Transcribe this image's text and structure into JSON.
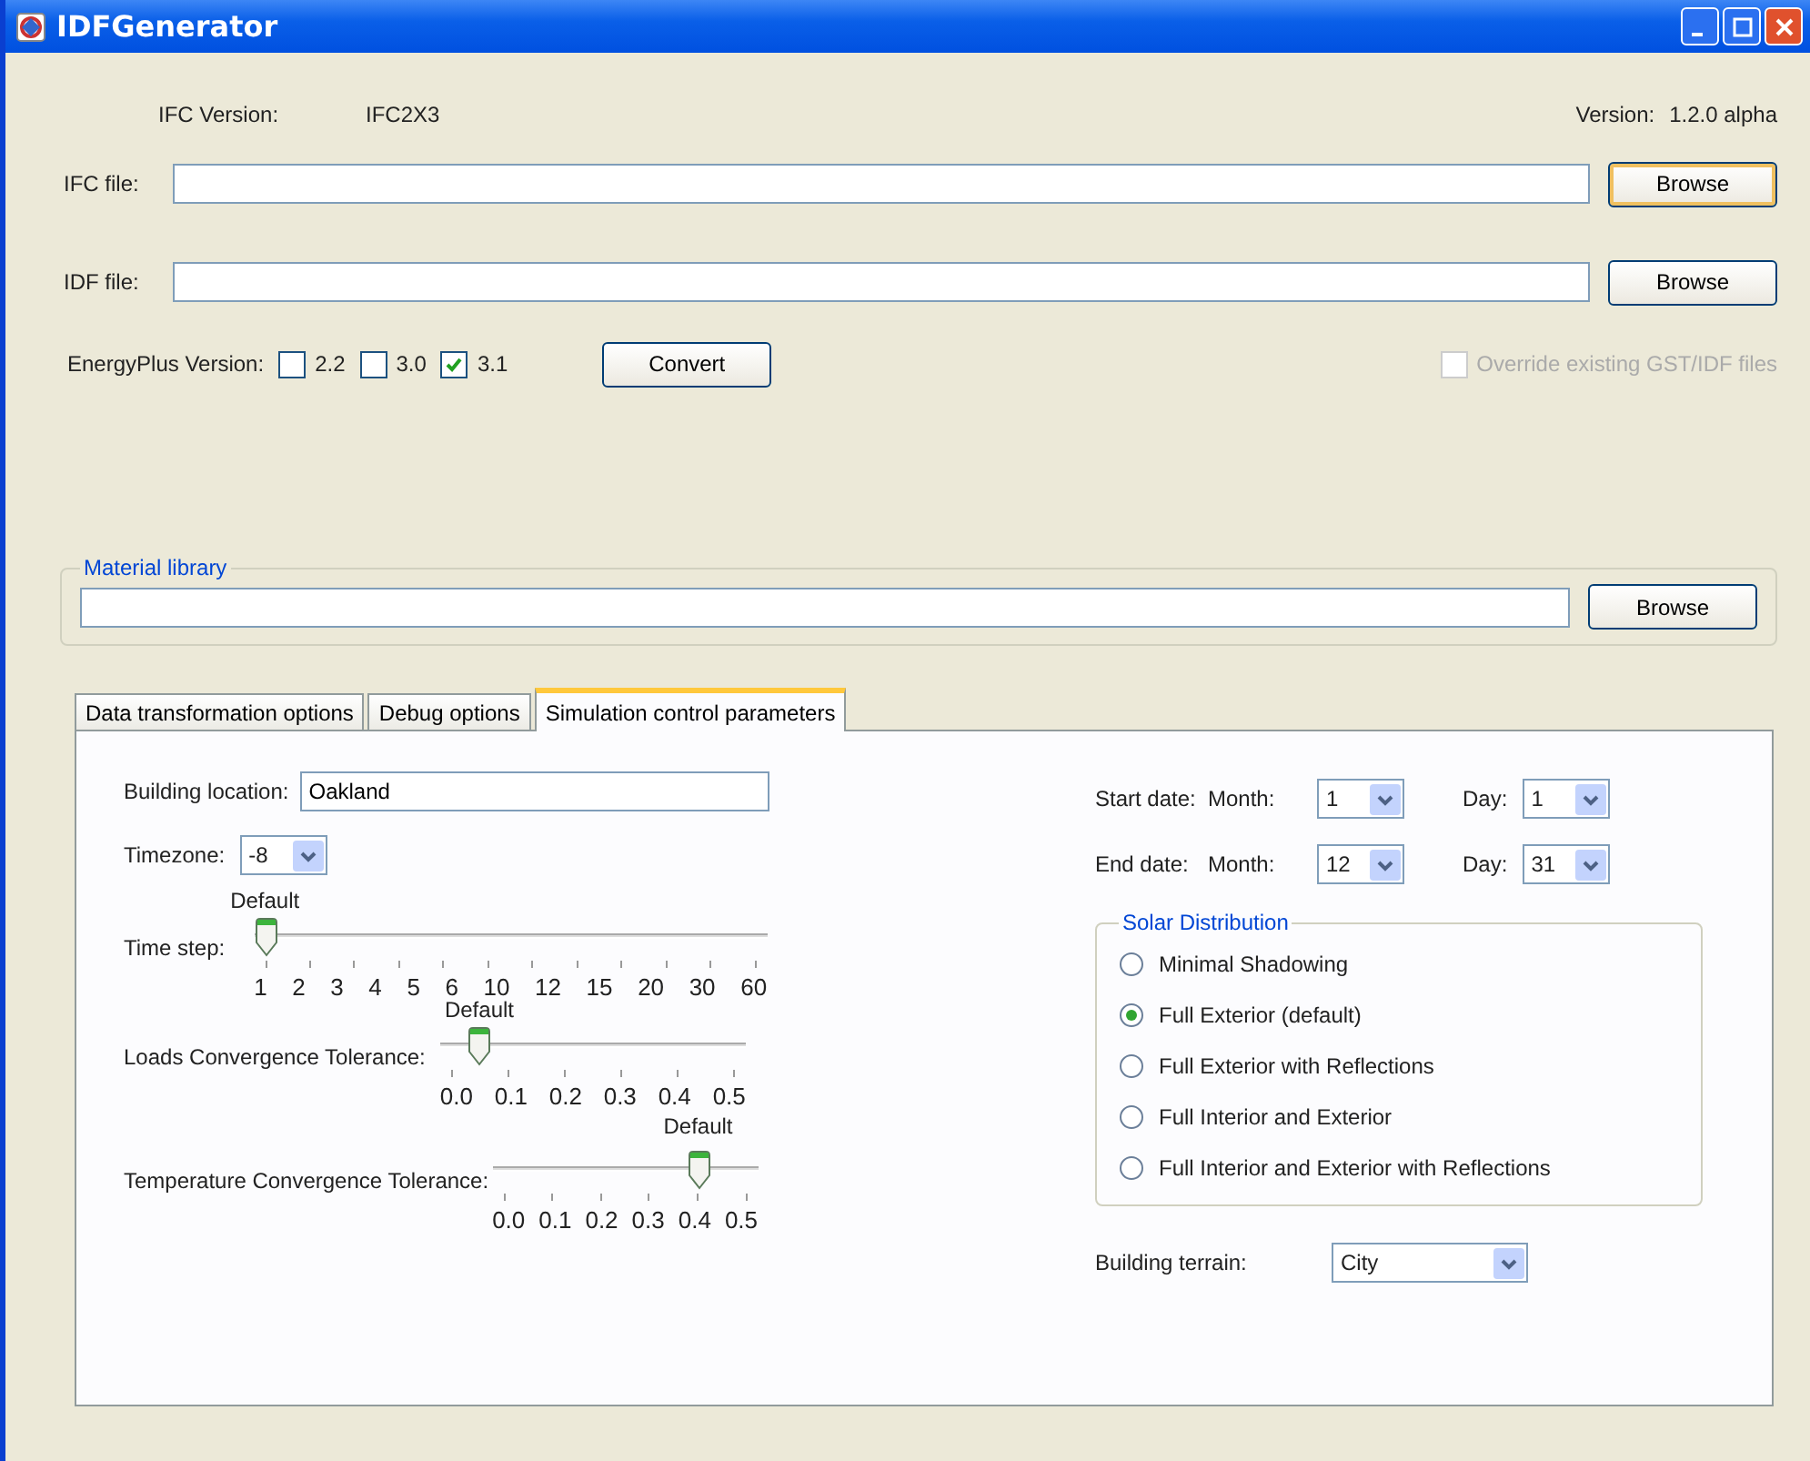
{
  "window": {
    "title": "IDFGenerator"
  },
  "ifc_version": {
    "label": "IFC Version:",
    "value": "IFC2X3"
  },
  "app_version": {
    "label": "Version:",
    "value": "1.2.0 alpha"
  },
  "ifc_file": {
    "label": "IFC file:",
    "button": "Browse",
    "focused": true
  },
  "idf_file": {
    "label": "IDF file:",
    "button": "Browse",
    "focused": false
  },
  "energyplus": {
    "label": "EnergyPlus Version:",
    "options": [
      {
        "label": "2.2",
        "checked": false
      },
      {
        "label": "3.0",
        "checked": false
      },
      {
        "label": "3.1",
        "checked": true
      }
    ]
  },
  "convert_button": "Convert",
  "override": {
    "label": "Override existing GST/IDF files",
    "checked": false,
    "disabled": true
  },
  "material_library": {
    "title": "Material library",
    "button": "Browse"
  },
  "tabs": [
    {
      "label": "Data transformation options",
      "selected": false
    },
    {
      "label": "Debug options",
      "selected": false
    },
    {
      "label": "Simulation control parameters",
      "selected": true
    }
  ],
  "building_location": {
    "label": "Building location:",
    "value": "Oakland"
  },
  "timezone": {
    "label": "Timezone:",
    "value": "-8"
  },
  "sliders": [
    {
      "label": "Time step:",
      "marker": "Default",
      "level": 0,
      "ticks": [
        "1",
        "2",
        "3",
        "4",
        "5",
        "6",
        "10",
        "12",
        "15",
        "20",
        "30",
        "60"
      ]
    },
    {
      "label": "Loads Convergence Tolerance:",
      "marker": "Default",
      "level": 0.1,
      "ticks": [
        "0.0",
        "0.1",
        "0.2",
        "0.3",
        "0.4",
        "0.5"
      ]
    },
    {
      "label": "Temperature Convergence Tolerance:",
      "marker": "Default",
      "level": 0.8,
      "ticks": [
        "0.0",
        "0.1",
        "0.2",
        "0.3",
        "0.4",
        "0.5"
      ]
    }
  ],
  "dates": [
    {
      "label": "Start date:",
      "month_label": "Month:",
      "month": "1",
      "day_label": "Day:",
      "day": "1"
    },
    {
      "label": "End date:",
      "month_label": "Month:",
      "month": "12",
      "day_label": "Day:",
      "day": "31"
    }
  ],
  "solar_distribution": {
    "title": "Solar Distribution",
    "options": [
      {
        "label": "Minimal Shadowing",
        "selected": false
      },
      {
        "label": "Full Exterior (default)",
        "selected": true
      },
      {
        "label": "Full Exterior with Reflections",
        "selected": false
      },
      {
        "label": "Full Interior and Exterior",
        "selected": false
      },
      {
        "label": "Full Interior and Exterior with Reflections",
        "selected": false
      }
    ]
  },
  "building_terrain": {
    "label": "Building terrain:",
    "value": "City"
  }
}
